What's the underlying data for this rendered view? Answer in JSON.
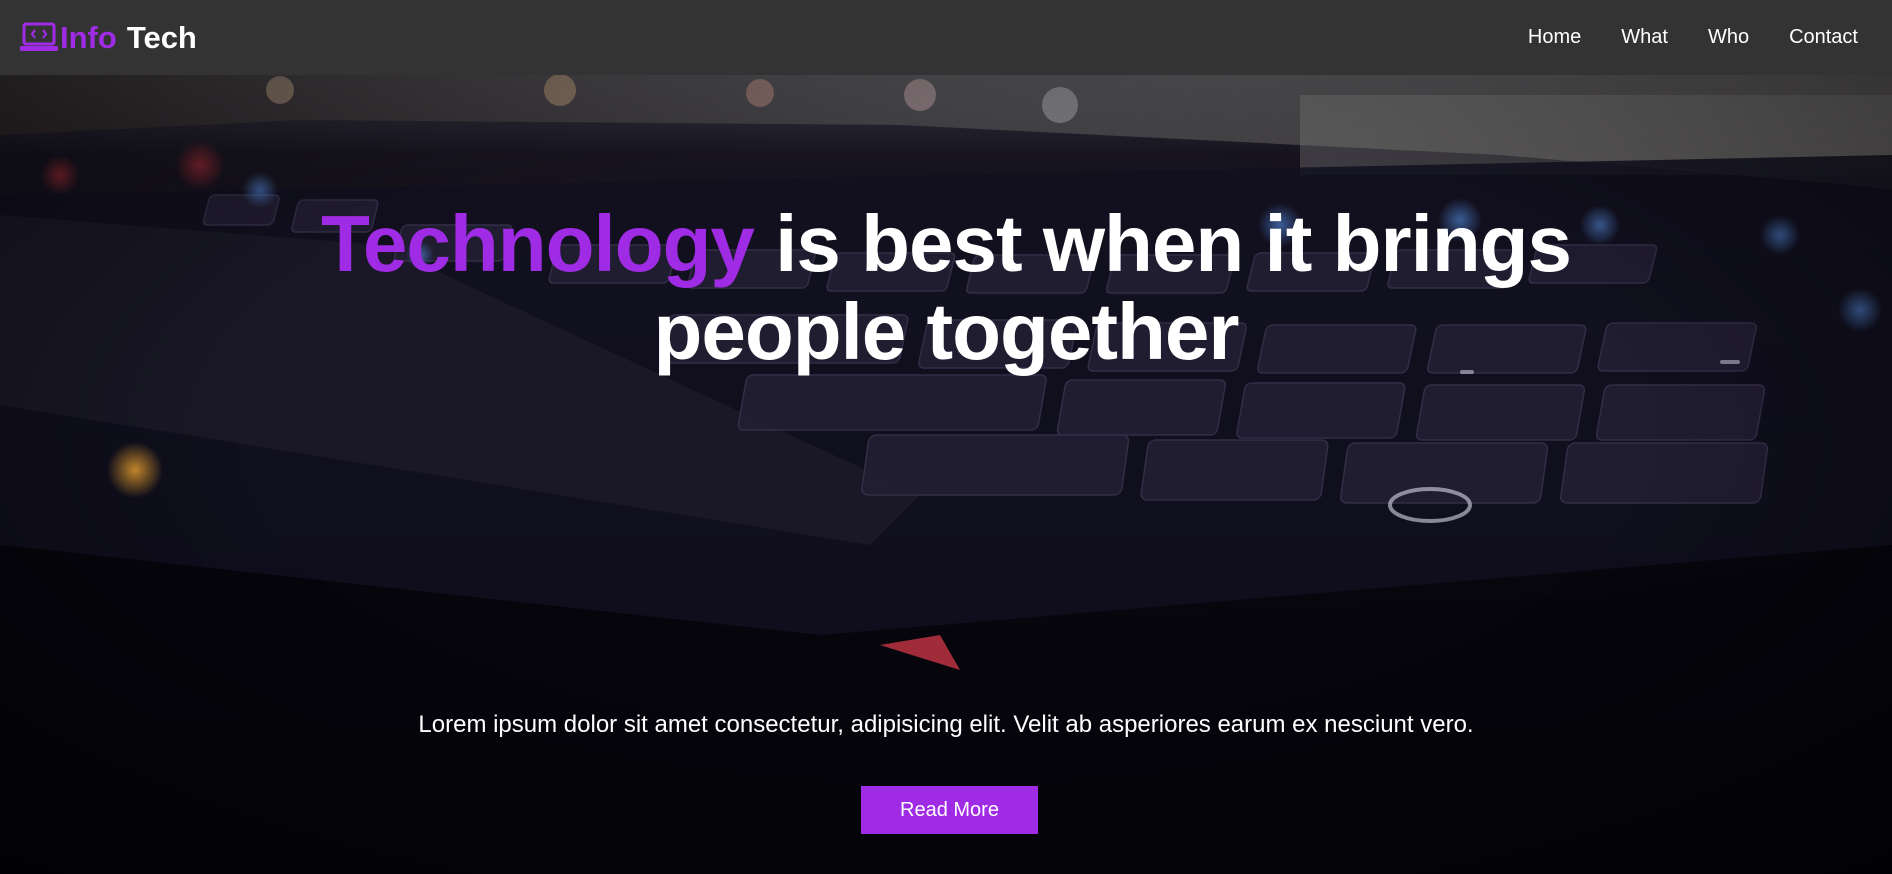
{
  "brand": {
    "icon": "laptop-code-icon",
    "name_part1": "Info",
    "name_part2": "Tech"
  },
  "nav": {
    "items": [
      {
        "label": "Home"
      },
      {
        "label": "What"
      },
      {
        "label": "Who"
      },
      {
        "label": "Contact"
      }
    ]
  },
  "hero": {
    "title_accent": "Technology",
    "title_rest_line1": " is best when it brings",
    "title_line2": "people together",
    "text": "Lorem ipsum dolor sit amet consectetur, adipisicing elit. Velit ab asperiores earum ex nesciunt vero.",
    "button_label": "Read More"
  },
  "colors": {
    "accent": "#a02be4",
    "navbar_bg": "#333333",
    "text": "#ffffff"
  }
}
